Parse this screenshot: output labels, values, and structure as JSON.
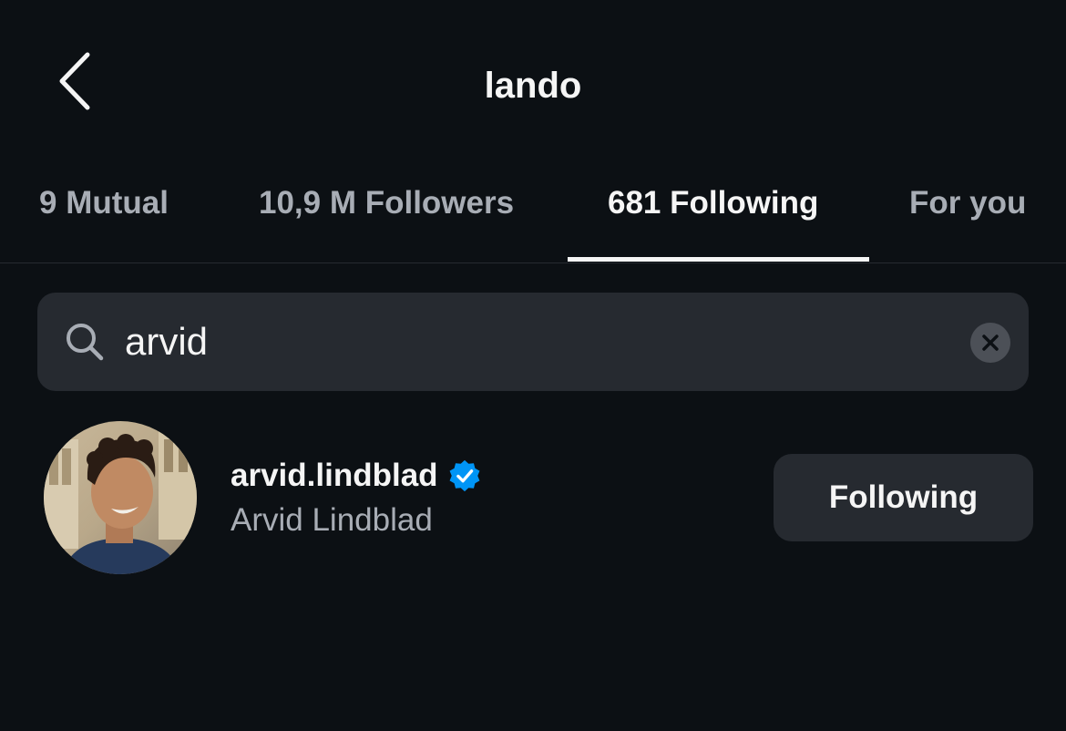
{
  "header": {
    "title": "lando",
    "back_icon": "chevron-left-icon"
  },
  "tabs": [
    {
      "label": "9 Mutual",
      "active": false
    },
    {
      "label": "10,9 M Followers",
      "active": false
    },
    {
      "label": "681 Following",
      "active": true
    },
    {
      "label": "For you",
      "active": false
    }
  ],
  "search": {
    "icon": "search-icon",
    "value": "arvid",
    "clear_icon": "close-icon"
  },
  "results": [
    {
      "username": "arvid.lindblad",
      "verified": true,
      "full_name": "Arvid Lindblad",
      "button_label": "Following"
    }
  ],
  "colors": {
    "background": "#0c1014",
    "primary_text": "#f5f5f5",
    "secondary_text": "#a8adb5",
    "surface": "#262a30",
    "verified_badge": "#0095f6"
  }
}
